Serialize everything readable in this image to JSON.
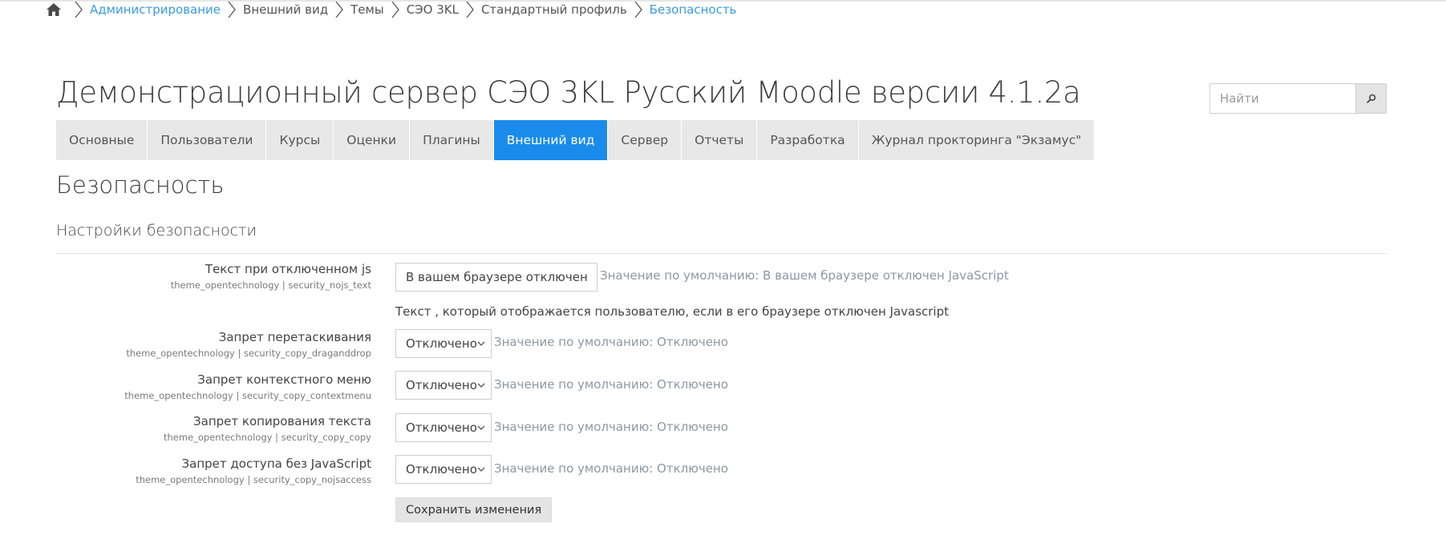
{
  "breadcrumb": {
    "items": [
      {
        "label": "Администрирование",
        "link": true
      },
      {
        "label": "Внешний вид",
        "link": false
      },
      {
        "label": "Темы",
        "link": false
      },
      {
        "label": "СЭО 3KL",
        "link": false
      },
      {
        "label": "Стандартный профиль",
        "link": false
      },
      {
        "label": "Безопасность",
        "link": true
      }
    ]
  },
  "header": {
    "site_title": "Демонстрационный сервер СЭО 3KL Русский Moodle версии 4.1.2a",
    "search_placeholder": "Найти"
  },
  "nav": {
    "tabs": [
      {
        "label": "Основные",
        "active": false
      },
      {
        "label": "Пользователи",
        "active": false
      },
      {
        "label": "Курсы",
        "active": false
      },
      {
        "label": "Оценки",
        "active": false
      },
      {
        "label": "Плагины",
        "active": false
      },
      {
        "label": "Внешний вид",
        "active": true
      },
      {
        "label": "Сервер",
        "active": false
      },
      {
        "label": "Отчеты",
        "active": false
      },
      {
        "label": "Разработка",
        "active": false
      },
      {
        "label": "Журнал прокторинга \"Экзамус\"",
        "active": false
      }
    ]
  },
  "page": {
    "heading": "Безопасность",
    "section_heading": "Настройки безопасности"
  },
  "settings": {
    "nojs_text": {
      "label": "Текст при отключенном js",
      "key": "theme_opentechnology | security_nojs_text",
      "value": "В вашем браузере отключен JavaScript",
      "default_note": "Значение по умолчанию: В вашем браузере отключен JavaScript",
      "description": "Текст , который отображается пользователю, если в его браузере отключен Javascript"
    },
    "selects": [
      {
        "label": "Запрет перетаскивания",
        "key": "theme_opentechnology | security_copy_draganddrop",
        "value": "Отключено",
        "default_note": "Значение по умолчанию: Отключено"
      },
      {
        "label": "Запрет контекстного меню",
        "key": "theme_opentechnology | security_copy_contextmenu",
        "value": "Отключено",
        "default_note": "Значение по умолчанию: Отключено"
      },
      {
        "label": "Запрет копирования текста",
        "key": "theme_opentechnology | security_copy_copy",
        "value": "Отключено",
        "default_note": "Значение по умолчанию: Отключено"
      },
      {
        "label": "Запрет доступа без JavaScript",
        "key": "theme_opentechnology | security_copy_nojsaccess",
        "value": "Отключено",
        "default_note": "Значение по умолчанию: Отключено"
      }
    ]
  },
  "actions": {
    "save_label": "Сохранить изменения"
  },
  "colors": {
    "accent": "#1a8bea",
    "link": "#3a9be0",
    "tab_bg": "#e8e8e8",
    "muted_note": "#8c98a4"
  },
  "icons": {
    "home": "home-icon",
    "separator": "chevron-right-icon",
    "search": "search-icon",
    "dropdown": "chevron-down-icon"
  }
}
